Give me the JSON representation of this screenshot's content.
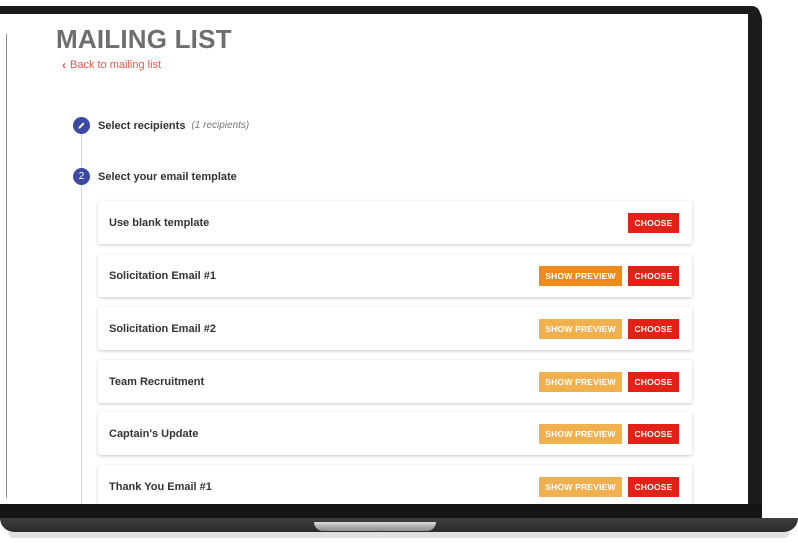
{
  "page": {
    "title": "MAILING LIST",
    "back_link": "Back to mailing list"
  },
  "steps": [
    {
      "number": "",
      "label": "Select recipients",
      "sub": "(1 recipients)",
      "icon": "pencil-icon"
    },
    {
      "number": "2",
      "label": "Select your email template"
    }
  ],
  "templates": [
    {
      "title": "Use blank template",
      "preview": null,
      "choose": "CHOOSE"
    },
    {
      "title": "Solicitation Email #1",
      "preview": "SHOW PREVIEW",
      "choose": "CHOOSE"
    },
    {
      "title": "Solicitation Email #2",
      "preview": "SHOW PREVIEW",
      "choose": "CHOOSE"
    },
    {
      "title": "Team Recruitment",
      "preview": "SHOW PREVIEW",
      "choose": "CHOOSE"
    },
    {
      "title": "Captain's Update",
      "preview": "SHOW PREVIEW",
      "choose": "CHOOSE"
    },
    {
      "title": "Thank You Email #1",
      "preview": "SHOW PREVIEW",
      "choose": "CHOOSE"
    }
  ],
  "colors": {
    "accent": "#3d4aa1",
    "choose": "#e22117",
    "preview": "#f0b04e",
    "preview_active": "#ec8b1a",
    "link": "#e2574c"
  }
}
